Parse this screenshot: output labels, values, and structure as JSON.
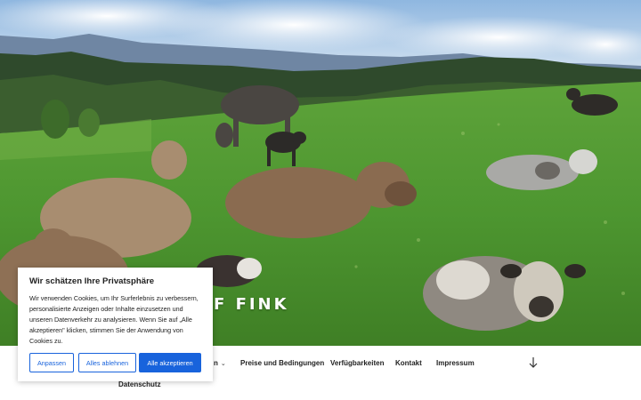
{
  "site": {
    "title_visible": "F FINK"
  },
  "nav": {
    "partial_item": "n",
    "items": [
      {
        "label": "Preise und Bedingungen"
      },
      {
        "label": "Verfügbarkeiten"
      },
      {
        "label": "Kontakt"
      },
      {
        "label": "Impressum"
      }
    ],
    "second_row_item": "Datenschutz",
    "scroll_icon": "arrow-down-icon"
  },
  "cookie_banner": {
    "title": "Wir schätzen Ihre Privatsphäre",
    "body": "Wir verwenden Cookies, um Ihr Surferlebnis zu verbessern, personalisierte Anzeigen oder Inhalte einzusetzen und unseren Datenverkehr zu analysieren. Wenn Sie auf „Alle akzeptieren\" klicken, stimmen Sie der Anwendung von Cookies zu.",
    "buttons": {
      "customize": "Anpassen",
      "reject": "Alles ablehnen",
      "accept": "Alle akzeptieren"
    },
    "accent_color": "#1863dc"
  },
  "hero": {
    "image_subject": "cows-on-meadow-photo"
  }
}
